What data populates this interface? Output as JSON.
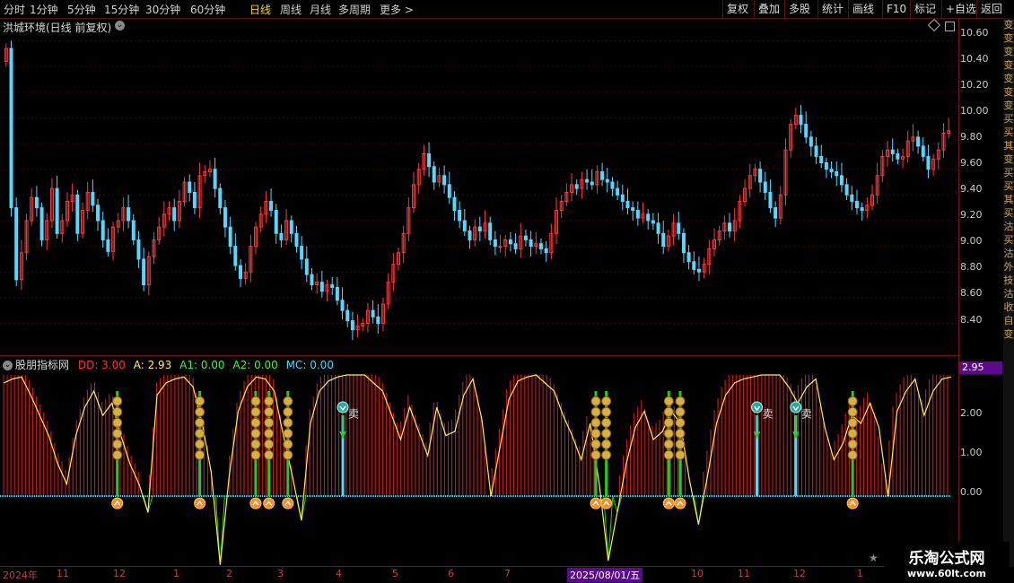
{
  "toolbar": {
    "periods": [
      "分时",
      "1分钟",
      "5分钟",
      "15分钟",
      "30分钟",
      "60分钟",
      "日线",
      "周线",
      "月线",
      "多周期",
      "更多 >"
    ],
    "active_period": "日线",
    "right_buttons": [
      "复权",
      "叠加",
      "多股",
      "统计",
      "画线",
      "F10",
      "标记",
      "+自选",
      "返回"
    ]
  },
  "main_chart": {
    "title": "洪城环境(日线 前复权)",
    "price_ticks": [
      "10.60",
      "10.40",
      "10.20",
      "10.00",
      "9.80",
      "9.60",
      "9.40",
      "9.20",
      "9.00",
      "8.80",
      "8.60",
      "8.40"
    ]
  },
  "indicator": {
    "name": "股朋指标网",
    "dd_label": "DD: 3.00",
    "a_label": "A: 2.93",
    "a1_label": "A1: 0.00",
    "a2_label": "A2: 0.00",
    "mc_label": "MC: 0.00",
    "current_value": "2.95",
    "ticks": [
      "2.00",
      "1.00",
      "0.00"
    ],
    "sell_label": "卖"
  },
  "time_axis": {
    "labels": [
      "2024年",
      "11",
      "12",
      "1",
      "2",
      "3",
      "4",
      "5",
      "6",
      "7",
      "2025/08/01/五",
      "10",
      "11",
      "12",
      "1"
    ]
  },
  "side_strip": [
    "变",
    "变",
    "变",
    "变",
    "变",
    "变",
    "变",
    "买",
    "买",
    "其",
    "变",
    "买",
    "买",
    "其",
    "买",
    "沽",
    "买",
    "沽",
    "外",
    "技",
    "沽",
    "收",
    "自",
    "变"
  ],
  "watermark": {
    "name": "乐淘公式网",
    "url": "www.60lt.com"
  },
  "colors": {
    "up": "#ff3838",
    "down": "#54d8ff",
    "indicator_line": "#ffee44",
    "bars": "#c01818",
    "zero_line": "#44d8ff",
    "signal_green": "#22cc22"
  },
  "chart_data": {
    "type": "candlestick",
    "title": "洪城环境(日线 前复权)",
    "price_ylim": [
      8.25,
      10.68
    ],
    "indicator_ylim": [
      -1.75,
      3.0
    ],
    "price_series": [
      10.54,
      9.3,
      8.74,
      8.95,
      9.2,
      9.38,
      9.3,
      9.05,
      9.2,
      9.45,
      9.1,
      9.2,
      9.35,
      9.4,
      9.1,
      9.28,
      9.42,
      9.32,
      9.2,
      9.05,
      8.96,
      9.15,
      9.2,
      9.3,
      9.2,
      9.05,
      8.9,
      8.7,
      8.92,
      9.05,
      9.15,
      9.25,
      9.3,
      9.2,
      9.35,
      9.5,
      9.42,
      9.3,
      9.55,
      9.58,
      9.6,
      9.45,
      9.3,
      9.15,
      9.0,
      8.85,
      8.75,
      8.8,
      9.0,
      9.15,
      9.25,
      9.35,
      9.28,
      9.1,
      9.05,
      9.2,
      9.1,
      9.0,
      8.9,
      8.78,
      8.7,
      8.72,
      8.65,
      8.7,
      8.68,
      8.58,
      8.5,
      8.42,
      8.35,
      8.38,
      8.4,
      8.5,
      8.45,
      8.4,
      8.55,
      8.72,
      8.86,
      8.95,
      9.1,
      9.3,
      9.48,
      9.6,
      9.72,
      9.62,
      9.5,
      9.55,
      9.48,
      9.38,
      9.28,
      9.2,
      9.12,
      9.05,
      9.15,
      9.12,
      9.18,
      9.05,
      9.0,
      9.0,
      9.05,
      9.02,
      8.98,
      9.08,
      9.05,
      9.0,
      9.02,
      8.98,
      8.95,
      9.1,
      9.28,
      9.35,
      9.42,
      9.48,
      9.45,
      9.52,
      9.5,
      9.48,
      9.58,
      9.52,
      9.5,
      9.45,
      9.4,
      9.35,
      9.3,
      9.28,
      9.22,
      9.25,
      9.2,
      9.18,
      9.1,
      9.0,
      9.08,
      9.18,
      9.1,
      8.95,
      8.88,
      8.82,
      8.8,
      8.86,
      8.98,
      9.05,
      9.12,
      9.18,
      9.12,
      9.2,
      9.35,
      9.45,
      9.55,
      9.6,
      9.5,
      9.42,
      9.3,
      9.22,
      9.4,
      9.75,
      9.95,
      10.02,
      9.95,
      9.85,
      9.78,
      9.7,
      9.65,
      9.6,
      9.58,
      9.55,
      9.48,
      9.4,
      9.35,
      9.3,
      9.28,
      9.32,
      9.4,
      9.55,
      9.7,
      9.75,
      9.72,
      9.68,
      9.7,
      9.82,
      9.85,
      9.78,
      9.7,
      9.6,
      9.68,
      9.75,
      9.88,
      9.9
    ],
    "indicator_series": [
      2.8,
      2.9,
      2.95,
      2.5,
      2.0,
      1.5,
      0.8,
      0.3,
      1.5,
      2.2,
      2.6,
      2.0,
      2.3,
      1.5,
      0.8,
      0.3,
      -0.4,
      2.5,
      2.8,
      2.9,
      2.95,
      2.7,
      1.8,
      0.6,
      -1.7,
      0.5,
      2.1,
      2.7,
      2.95,
      2.9,
      2.6,
      1.5,
      0.5,
      -0.6,
      1.8,
      2.6,
      2.85,
      2.95,
      3.0,
      3.0,
      3.0,
      2.8,
      2.6,
      2.0,
      1.4,
      2.2,
      1.6,
      1.0,
      2.2,
      1.5,
      1.6,
      2.5,
      2.9,
      1.9,
      0.0,
      1.2,
      2.4,
      2.85,
      2.95,
      3.0,
      2.8,
      2.6,
      2.0,
      1.5,
      0.9,
      1.8,
      0.3,
      -1.6,
      -0.4,
      0.8,
      1.7,
      2.1,
      1.4,
      1.6,
      2.1,
      1.8,
      0.4,
      -0.7,
      0.5,
      1.8,
      2.5,
      2.8,
      2.9,
      2.95,
      3.0,
      3.0,
      3.0,
      2.7,
      2.3,
      2.7,
      2.9,
      1.7,
      0.9,
      1.3,
      2.0,
      1.8,
      2.3,
      1.7,
      0.0,
      2.1,
      2.6,
      2.9,
      2.0,
      2.6,
      2.9,
      2.95
    ],
    "sell_signal_positions": [
      0.358,
      0.795,
      0.836
    ],
    "buy_signal_positions": [
      0.12,
      0.207,
      0.266,
      0.28,
      0.3,
      0.625,
      0.636,
      0.702,
      0.714,
      0.896
    ]
  }
}
